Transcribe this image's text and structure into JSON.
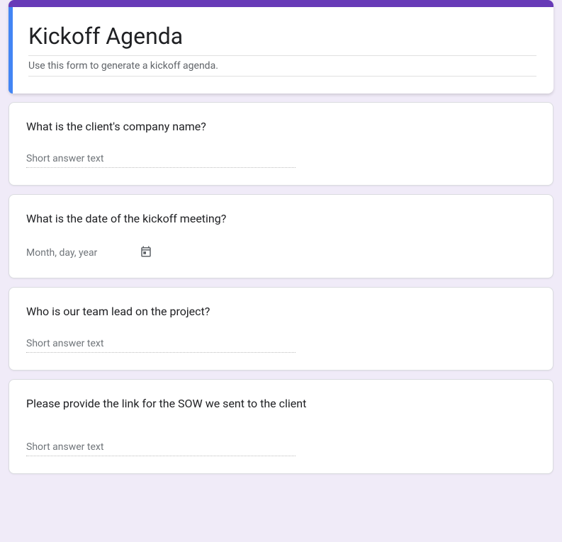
{
  "header": {
    "title": "Kickoff Agenda",
    "description": "Use this form to generate a kickoff agenda."
  },
  "questions": [
    {
      "title": "What is the client's company name?",
      "placeholder": "Short answer text",
      "type": "short_answer"
    },
    {
      "title": "What is the date of the kickoff meeting?",
      "placeholder": "Month, day, year",
      "type": "date"
    },
    {
      "title": "Who is our team lead on the project?",
      "placeholder": "Short answer text",
      "type": "short_answer"
    },
    {
      "title": "Please provide the link for the SOW we sent to the client",
      "placeholder": "Short answer text",
      "type": "short_answer"
    }
  ]
}
